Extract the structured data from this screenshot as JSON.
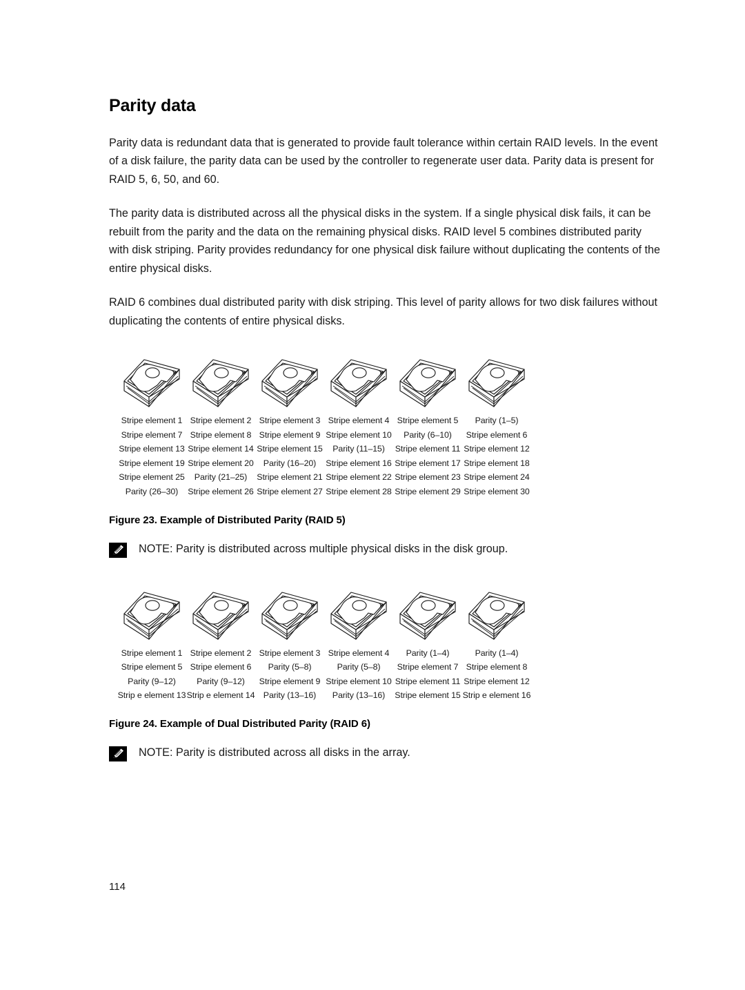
{
  "page": {
    "heading": "Parity data",
    "page_number": "114",
    "paragraphs": [
      "Parity data is redundant data that is generated to provide fault tolerance within certain RAID levels. In the event of a disk failure, the parity data can be used by the controller to regenerate user data. Parity data is present for RAID 5, 6, 50, and 60.",
      "The parity data is distributed across all the physical disks in the system. If a single physical disk fails, it can be rebuilt from the parity and the data on the remaining physical disks. RAID level 5 combines distributed parity with disk striping. Parity provides redundancy for one physical disk failure without duplicating the contents of the entire physical disks.",
      "RAID 6 combines dual distributed parity with disk striping. This level of parity allows for two disk failures without duplicating the contents of entire physical disks."
    ]
  },
  "figure_raid5": {
    "disk_count": 6,
    "disk_icon": "hard-disk-icon",
    "rows": [
      [
        "Stripe element 1",
        "Stripe element 2",
        "Stripe element 3",
        "Stripe element 4",
        "Stripe element 5",
        "Parity (1–5)"
      ],
      [
        "Stripe element 7",
        "Stripe element 8",
        "Stripe element 9",
        "Stripe element 10",
        "Parity (6–10)",
        "Stripe element 6"
      ],
      [
        "Stripe element 13",
        "Stripe element 14",
        "Stripe element 15",
        "Parity (11–15)",
        "Stripe element 11",
        "Stripe element 12"
      ],
      [
        "Stripe element 19",
        "Stripe element 20",
        "Parity (16–20)",
        "Stripe element 16",
        "Stripe element 17",
        "Stripe element 18"
      ],
      [
        "Stripe element 25",
        "Parity (21–25)",
        "Stripe element 21",
        "Stripe element 22",
        "Stripe element 23",
        "Stripe element 24"
      ],
      [
        "Parity (26–30)",
        "Stripe element 26",
        "Stripe element 27",
        "Stripe element 28",
        "Stripe element 29",
        "Stripe element 30"
      ]
    ],
    "caption": "Figure 23. Example of Distributed Parity (RAID 5)",
    "note": {
      "icon": "note-pencil-icon",
      "text": "NOTE: Parity is distributed across multiple physical disks in the disk group."
    }
  },
  "figure_raid6": {
    "disk_count": 6,
    "disk_icon": "hard-disk-icon",
    "rows": [
      [
        "Stripe element 1",
        "Stripe element 2",
        "Stripe element 3",
        "Stripe element 4",
        "Parity (1–4)",
        "Parity (1–4)"
      ],
      [
        "Stripe element 5",
        "Stripe element 6",
        "Parity (5–8)",
        "Parity (5–8)",
        "Stripe element 7",
        "Stripe element 8"
      ],
      [
        "Parity (9–12)",
        "Parity (9–12)",
        "Stripe element 9",
        "Stripe element 10",
        "Stripe element 11",
        "Stripe element 12"
      ],
      [
        "Strip e element 13",
        "Strip e element 14",
        "Parity (13–16)",
        "Parity (13–16)",
        "Stripe element 15",
        "Strip e element 16"
      ]
    ],
    "caption": "Figure 24. Example of Dual Distributed Parity (RAID 6)",
    "note": {
      "icon": "note-pencil-icon",
      "text": "NOTE: Parity is distributed across all disks in the array."
    }
  }
}
